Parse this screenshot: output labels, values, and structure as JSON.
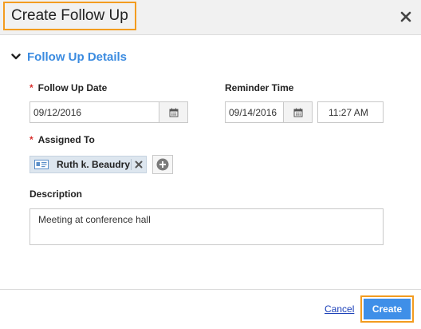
{
  "dialog": {
    "title": "Create Follow Up"
  },
  "section": {
    "label": "Follow Up Details"
  },
  "fields": {
    "required_marker": "*",
    "follow_up_date": {
      "label": "Follow Up Date",
      "value": "09/12/2016"
    },
    "reminder_time": {
      "label": "Reminder Time",
      "date_value": "09/14/2016",
      "time_value": "11:27 AM"
    },
    "assigned_to": {
      "label": "Assigned To",
      "assignee": "Ruth k. Beaudry"
    },
    "description": {
      "label": "Description",
      "value": "Meeting at conference hall"
    }
  },
  "footer": {
    "cancel_label": "Cancel",
    "create_label": "Create"
  },
  "colors": {
    "accent_blue": "#3b8be0",
    "button_blue": "#3f8fe8",
    "highlight_orange": "#f39c1f",
    "required_red": "#d9302e"
  },
  "icons": [
    "close-icon",
    "chevron-down-icon",
    "calendar-icon",
    "contact-card-icon",
    "remove-icon",
    "add-icon"
  ]
}
